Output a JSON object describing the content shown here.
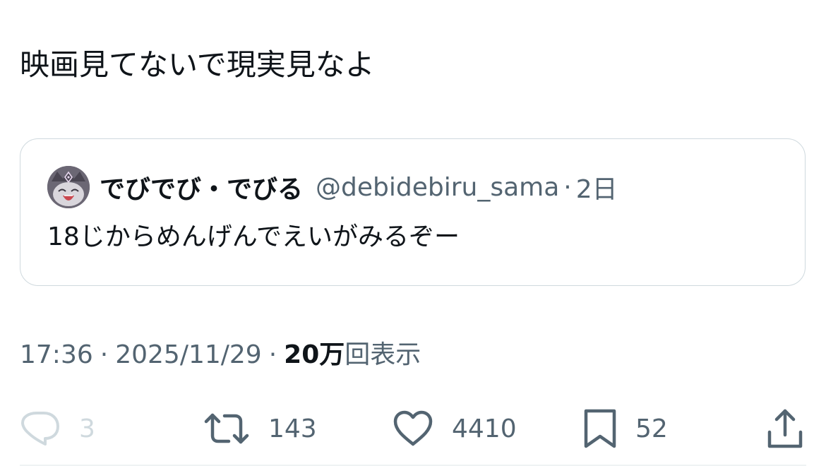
{
  "tweet": {
    "text": "映画見てないで現実見なよ"
  },
  "quoted_tweet": {
    "display_name": "でびでび・でびる",
    "handle": "@debidebiru_sama",
    "separator": "·",
    "time_ago": "2日",
    "text": "18じからめんげんでえいがみるぞー"
  },
  "meta": {
    "time": "17:36",
    "separator": "·",
    "date": "2025/11/29",
    "views_count": "20万",
    "views_label": "回表示"
  },
  "actions": {
    "reply_count": "3",
    "retweet_count": "143",
    "like_count": "4410",
    "bookmark_count": "52"
  },
  "icons": {
    "reply": "reply-icon",
    "retweet": "retweet-icon",
    "like": "heart-icon",
    "bookmark": "bookmark-icon",
    "share": "share-icon"
  },
  "colors": {
    "text": "#0f1419",
    "secondary": "#536471",
    "border": "#cfd9de",
    "reply_muted": "#cfd9de"
  }
}
